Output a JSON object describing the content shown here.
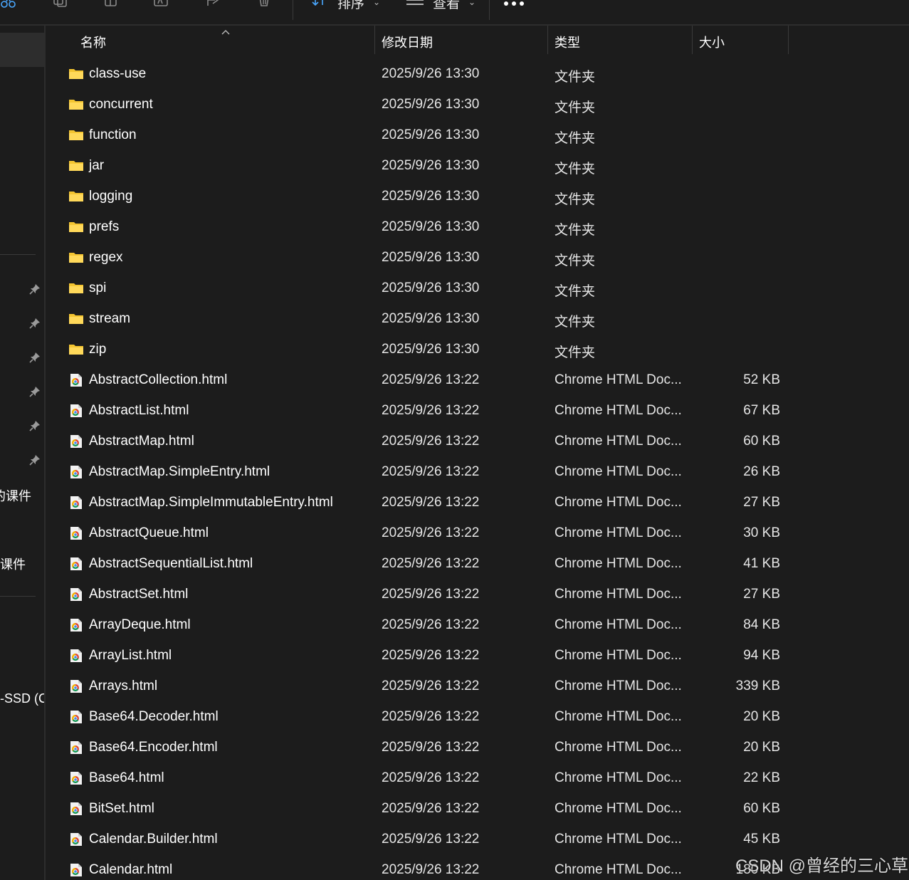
{
  "toolbar": {
    "sort_label": "排序",
    "view_label": "查看"
  },
  "sidebar": {
    "items": [
      {
        "label": "的课件"
      },
      {
        "label": "课件"
      },
      {
        "label": "-SSD (C"
      }
    ]
  },
  "columns": {
    "name": "名称",
    "date": "修改日期",
    "type": "类型",
    "size": "大小"
  },
  "files": [
    {
      "name": "class-use",
      "date": "2025/9/26 13:30",
      "type": "文件夹",
      "size": "",
      "icon": "folder-icon"
    },
    {
      "name": "concurrent",
      "date": "2025/9/26 13:30",
      "type": "文件夹",
      "size": "",
      "icon": "folder-icon"
    },
    {
      "name": "function",
      "date": "2025/9/26 13:30",
      "type": "文件夹",
      "size": "",
      "icon": "folder-icon"
    },
    {
      "name": "jar",
      "date": "2025/9/26 13:30",
      "type": "文件夹",
      "size": "",
      "icon": "folder-icon"
    },
    {
      "name": "logging",
      "date": "2025/9/26 13:30",
      "type": "文件夹",
      "size": "",
      "icon": "folder-icon"
    },
    {
      "name": "prefs",
      "date": "2025/9/26 13:30",
      "type": "文件夹",
      "size": "",
      "icon": "folder-icon"
    },
    {
      "name": "regex",
      "date": "2025/9/26 13:30",
      "type": "文件夹",
      "size": "",
      "icon": "folder-icon"
    },
    {
      "name": "spi",
      "date": "2025/9/26 13:30",
      "type": "文件夹",
      "size": "",
      "icon": "folder-icon"
    },
    {
      "name": "stream",
      "date": "2025/9/26 13:30",
      "type": "文件夹",
      "size": "",
      "icon": "folder-icon"
    },
    {
      "name": "zip",
      "date": "2025/9/26 13:30",
      "type": "文件夹",
      "size": "",
      "icon": "folder-icon"
    },
    {
      "name": "AbstractCollection.html",
      "date": "2025/9/26 13:22",
      "type": "Chrome HTML Doc...",
      "size": "52 KB",
      "icon": "chrome-html-icon"
    },
    {
      "name": "AbstractList.html",
      "date": "2025/9/26 13:22",
      "type": "Chrome HTML Doc...",
      "size": "67 KB",
      "icon": "chrome-html-icon"
    },
    {
      "name": "AbstractMap.html",
      "date": "2025/9/26 13:22",
      "type": "Chrome HTML Doc...",
      "size": "60 KB",
      "icon": "chrome-html-icon"
    },
    {
      "name": "AbstractMap.SimpleEntry.html",
      "date": "2025/9/26 13:22",
      "type": "Chrome HTML Doc...",
      "size": "26 KB",
      "icon": "chrome-html-icon"
    },
    {
      "name": "AbstractMap.SimpleImmutableEntry.html",
      "date": "2025/9/26 13:22",
      "type": "Chrome HTML Doc...",
      "size": "27 KB",
      "icon": "chrome-html-icon"
    },
    {
      "name": "AbstractQueue.html",
      "date": "2025/9/26 13:22",
      "type": "Chrome HTML Doc...",
      "size": "30 KB",
      "icon": "chrome-html-icon"
    },
    {
      "name": "AbstractSequentialList.html",
      "date": "2025/9/26 13:22",
      "type": "Chrome HTML Doc...",
      "size": "41 KB",
      "icon": "chrome-html-icon"
    },
    {
      "name": "AbstractSet.html",
      "date": "2025/9/26 13:22",
      "type": "Chrome HTML Doc...",
      "size": "27 KB",
      "icon": "chrome-html-icon"
    },
    {
      "name": "ArrayDeque.html",
      "date": "2025/9/26 13:22",
      "type": "Chrome HTML Doc...",
      "size": "84 KB",
      "icon": "chrome-html-icon"
    },
    {
      "name": "ArrayList.html",
      "date": "2025/9/26 13:22",
      "type": "Chrome HTML Doc...",
      "size": "94 KB",
      "icon": "chrome-html-icon"
    },
    {
      "name": "Arrays.html",
      "date": "2025/9/26 13:22",
      "type": "Chrome HTML Doc...",
      "size": "339 KB",
      "icon": "chrome-html-icon"
    },
    {
      "name": "Base64.Decoder.html",
      "date": "2025/9/26 13:22",
      "type": "Chrome HTML Doc...",
      "size": "20 KB",
      "icon": "chrome-html-icon"
    },
    {
      "name": "Base64.Encoder.html",
      "date": "2025/9/26 13:22",
      "type": "Chrome HTML Doc...",
      "size": "20 KB",
      "icon": "chrome-html-icon"
    },
    {
      "name": "Base64.html",
      "date": "2025/9/26 13:22",
      "type": "Chrome HTML Doc...",
      "size": "22 KB",
      "icon": "chrome-html-icon"
    },
    {
      "name": "BitSet.html",
      "date": "2025/9/26 13:22",
      "type": "Chrome HTML Doc...",
      "size": "60 KB",
      "icon": "chrome-html-icon"
    },
    {
      "name": "Calendar.Builder.html",
      "date": "2025/9/26 13:22",
      "type": "Chrome HTML Doc...",
      "size": "45 KB",
      "icon": "chrome-html-icon"
    },
    {
      "name": "Calendar.html",
      "date": "2025/9/26 13:22",
      "type": "Chrome HTML Doc...",
      "size": "180 KB",
      "icon": "chrome-html-icon"
    }
  ],
  "watermark": "CSDN @曾经的三心草",
  "colors": {
    "background": "#1c1c1c",
    "folder": "#f4c531",
    "accent": "#4aa8ff"
  }
}
